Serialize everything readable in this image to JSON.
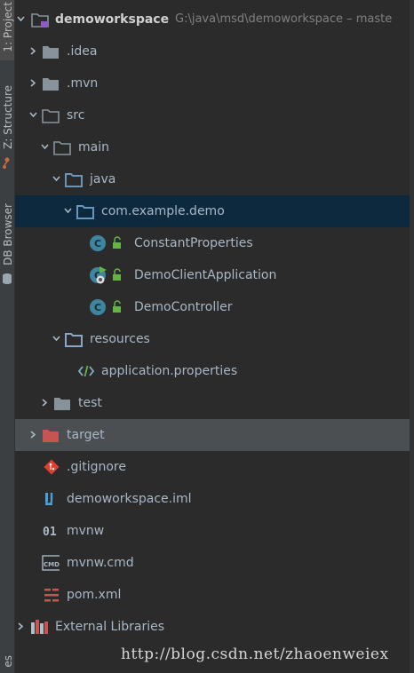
{
  "sidebar": {
    "tabs": [
      {
        "label": "1: Project"
      },
      {
        "label": "Z: Structure"
      },
      {
        "label": "DB Browser"
      },
      {
        "label": "es"
      }
    ]
  },
  "tree": {
    "root": {
      "label": "demoworkspace",
      "path": "G:\\java\\msd\\demoworkspace  –  maste"
    },
    "items": [
      {
        "label": ".idea"
      },
      {
        "label": ".mvn"
      },
      {
        "label": "src"
      },
      {
        "label": "main"
      },
      {
        "label": "java"
      },
      {
        "label": "com.example.demo"
      },
      {
        "label": "ConstantProperties"
      },
      {
        "label": "DemoClientApplication"
      },
      {
        "label": "DemoController"
      },
      {
        "label": "resources"
      },
      {
        "label": "application.properties"
      },
      {
        "label": "test"
      },
      {
        "label": "target"
      },
      {
        "label": ".gitignore"
      },
      {
        "label": "demoworkspace.iml"
      },
      {
        "label": "mvnw"
      },
      {
        "label": "mvnw.cmd"
      },
      {
        "label": "pom.xml"
      },
      {
        "label": "External Libraries"
      }
    ]
  },
  "colors": {
    "background": "#2b2b2b",
    "selected_row": "#0d293e",
    "excluded_row": "#4b4f52",
    "folder": "#87939a",
    "source_folder": "#6897bb",
    "resources_folder": "#89a7c8",
    "excluded_folder": "#c75450",
    "class_icon": "#3e86a0"
  },
  "icons": {
    "root": "module-folder-icon",
    "folder": "folder-icon",
    "class": "class-icon",
    "spring_boot_app": "spring-boot-class-icon",
    "properties": "properties-file-icon",
    "git": "git-file-icon",
    "iml": "intellij-module-file-icon",
    "shell": "binary-file-icon",
    "cmd": "cmd-file-icon",
    "maven": "maven-pom-icon",
    "libraries": "libraries-icon"
  },
  "watermark": "http://blog.csdn.net/zhaoenweiex"
}
